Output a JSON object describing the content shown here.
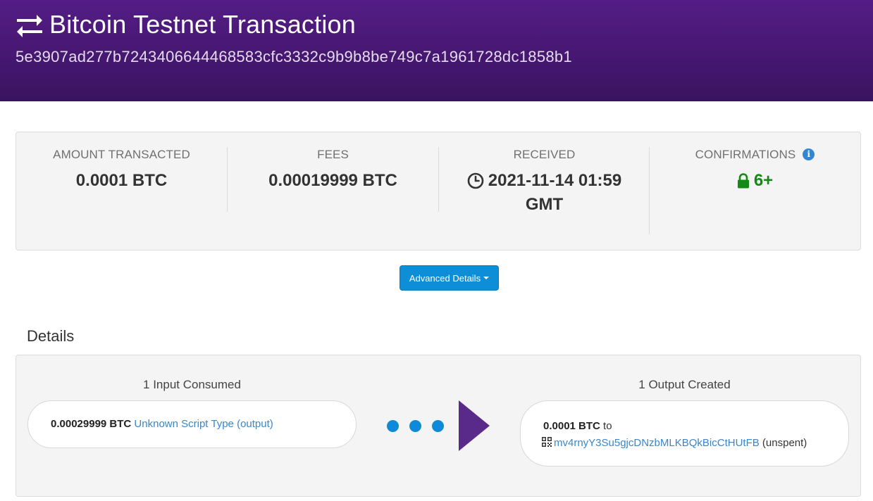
{
  "header": {
    "title": "Bitcoin Testnet Transaction",
    "hash": "5e3907ad277b7243406644468583cfc3332c9b9b8be749c7a1961728dc1858b1",
    "icon": "exchange-arrows-icon"
  },
  "summary": {
    "amount": {
      "label": "AMOUNT TRANSACTED",
      "value": "0.0001 BTC"
    },
    "fees": {
      "label": "FEES",
      "value": "0.00019999 BTC"
    },
    "received": {
      "label": "RECEIVED",
      "value_line1": "2021-11-14 01:59",
      "value_line2": "GMT"
    },
    "confirmations": {
      "label": "CONFIRMATIONS",
      "value": "6+",
      "info_glyph": "i"
    }
  },
  "advanced_button": {
    "label": "Advanced Details"
  },
  "details": {
    "heading": "Details",
    "inputs_title": "1 Input Consumed",
    "outputs_title": "1 Output Created",
    "input": {
      "amount": "0.00029999 BTC",
      "script_type": "Unknown Script Type",
      "output_link": "(output)",
      "open_paren": "(",
      "output_word": "output",
      "close_paren": ")"
    },
    "output": {
      "amount": "0.0001 BTC",
      "to_word": "to",
      "address": "mv4rnyY3Su5gjcDNzbMLKBQkBicCtHUtFB",
      "status": "(unspent)"
    }
  },
  "colors": {
    "header_bg": "#4a1a78",
    "accent_blue": "#0f8ed8",
    "arrow_purple": "#5a2a8a",
    "confirm_green": "#138a13",
    "link_blue": "#3a86c8"
  }
}
